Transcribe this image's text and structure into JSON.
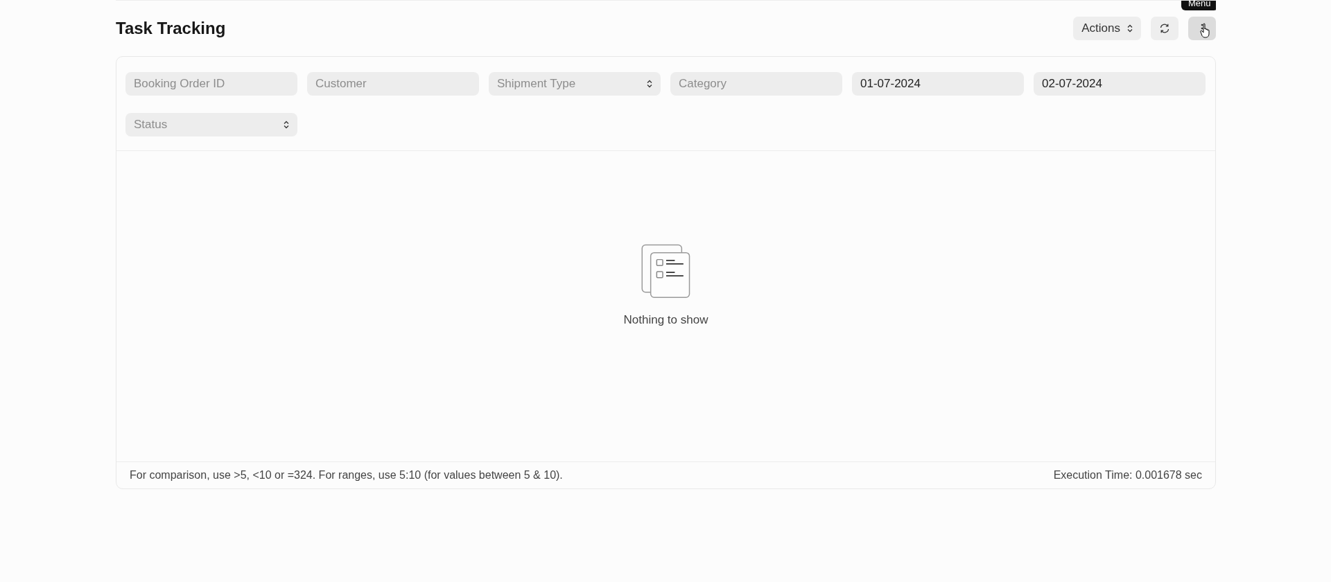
{
  "page": {
    "title": "Task Tracking"
  },
  "toolbar": {
    "actions_button": "Actions",
    "tooltip": "Menu"
  },
  "filters": [
    {
      "kind": "text",
      "placeholder": "Booking Order ID"
    },
    {
      "kind": "text",
      "placeholder": "Customer"
    },
    {
      "kind": "select",
      "placeholder": "Shipment Type"
    },
    {
      "kind": "text",
      "placeholder": "Category"
    },
    {
      "kind": "date",
      "value": "01-07-2024"
    },
    {
      "kind": "date",
      "value": "02-07-2024"
    },
    {
      "kind": "select",
      "placeholder": "Status"
    }
  ],
  "empty_state": {
    "message": "Nothing to show"
  },
  "footer": {
    "hint": "For comparison, use >5, <10 or =324. For ranges, use 5:10 (for values between 5 & 10).",
    "execution_time": "Execution Time: 0.001678 sec"
  }
}
